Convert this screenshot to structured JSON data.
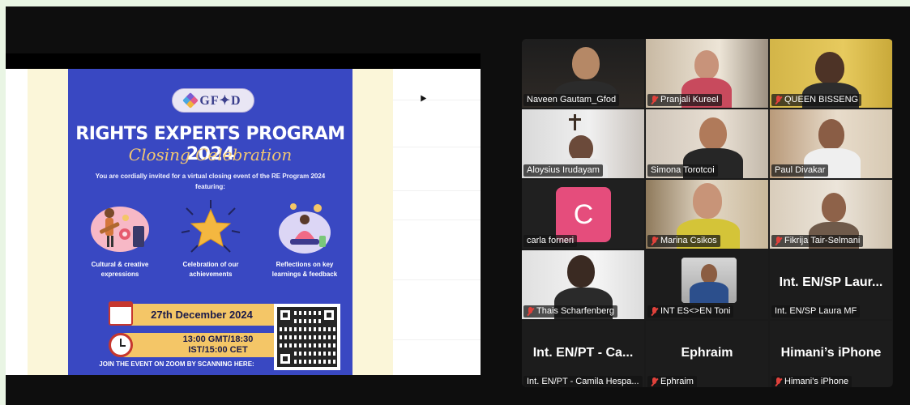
{
  "poster": {
    "logo": "GF✦D",
    "title": "RIGHTS EXPERTS PROGRAM 2024",
    "subtitle": "Closing Celebration",
    "intro": "You are cordially invited for a virtual closing event of the RE Program 2024 featuring:",
    "features": [
      {
        "caption": "Cultural & creative expressions",
        "icon": "music-performers-illustration"
      },
      {
        "caption": "Celebration of our achievements",
        "icon": "star-illustration"
      },
      {
        "caption": "Reflections on key learnings & feedback",
        "icon": "meditating-person-illustration"
      }
    ],
    "date": "27th December 2024",
    "time_line1": "13:00 GMT/18:30",
    "time_line2": "IST/15:00 CET",
    "join": "JOIN THE EVENT ON ZOOM BY SCANNING HERE:"
  },
  "participants": [
    {
      "name": "Naveen Gautam_Gfod",
      "muted": false,
      "active": false
    },
    {
      "name": "Pranjali Kureel",
      "muted": true,
      "active": false
    },
    {
      "name": "QUEEN BISSENG",
      "muted": true,
      "active": false
    },
    {
      "name": "Aloysius Irudayam",
      "muted": false,
      "active": false
    },
    {
      "name": "Simona Torotcoi",
      "muted": false,
      "active": false
    },
    {
      "name": "Paul Divakar",
      "muted": false,
      "active": true
    },
    {
      "name": "carla forneri",
      "muted": false,
      "active": false,
      "avatar_letter": "C"
    },
    {
      "name": "Marina Csikos",
      "muted": true,
      "active": false
    },
    {
      "name": "Fikrija Tair-Selmani",
      "muted": true,
      "active": false
    },
    {
      "name": "Thais Scharfenberg",
      "muted": true,
      "active": false
    },
    {
      "name": "INT ES<>EN Toni",
      "muted": true,
      "active": false
    },
    {
      "name": "Int. EN/SP Laura MF",
      "muted": false,
      "active": false,
      "big_label": "Int. EN/SP Laur..."
    },
    {
      "name": "Int. EN/PT - Camila Hespa...",
      "muted": false,
      "active": false,
      "big_label": "Int. EN/PT - Ca..."
    },
    {
      "name": "Ephraim",
      "muted": true,
      "active": false,
      "big_label": "Ephraim"
    },
    {
      "name": "Himani's iPhone",
      "muted": true,
      "active": false,
      "big_label": "Himani’s iPhone"
    }
  ],
  "colors": {
    "poster_bg": "#3948c2",
    "accent_gold": "#f4c667",
    "active_speaker": "#26d96a",
    "muted_red": "#e0413b",
    "avatar_pink": "#e54d7c"
  }
}
